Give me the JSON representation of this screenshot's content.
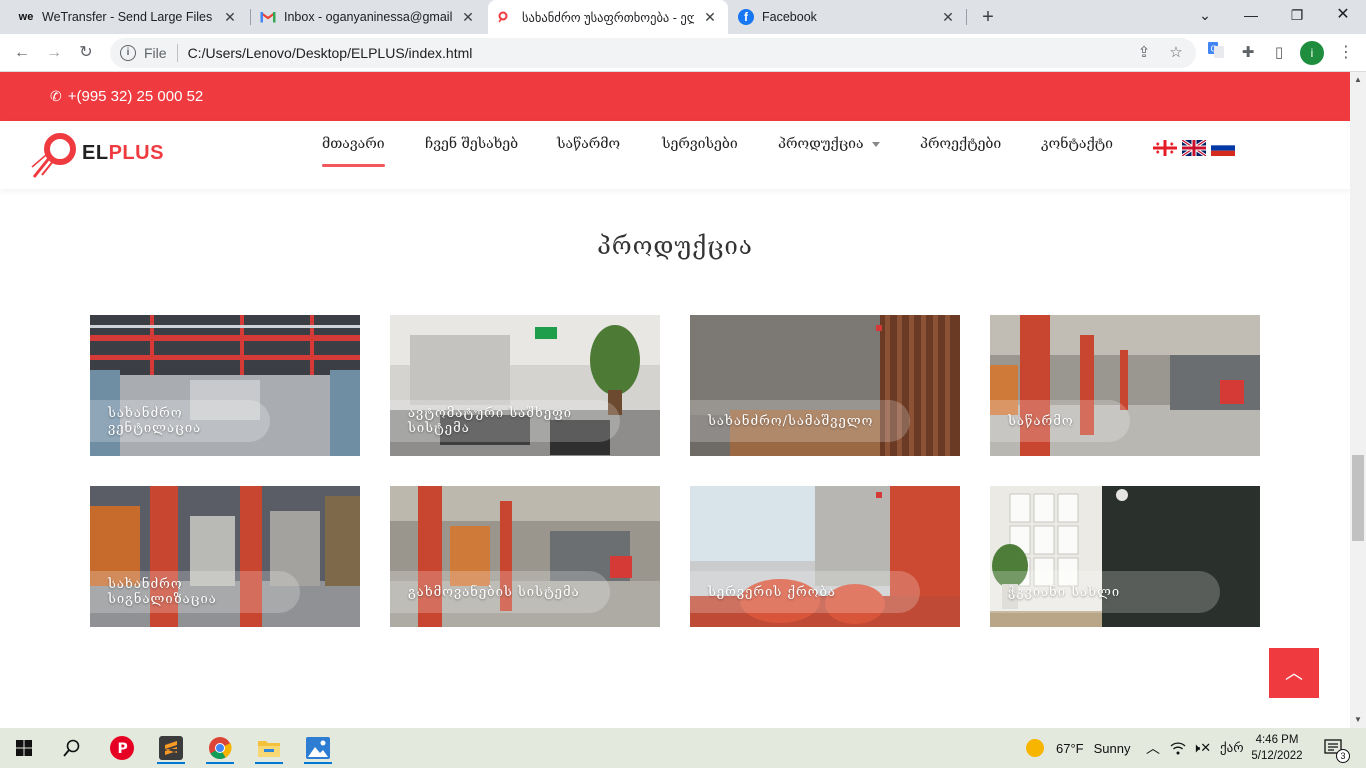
{
  "browser": {
    "tabs": [
      {
        "title": "WeTransfer - Send Large Files & S",
        "favicon": "WE",
        "active": false
      },
      {
        "title": "Inbox - oganyaninessa@gmail.co",
        "favicon": "M",
        "active": false
      },
      {
        "title": "სახანძრო უსაფრთხოება - ელ",
        "favicon": "logo",
        "active": true
      },
      {
        "title": "Facebook",
        "favicon": "f",
        "active": false
      }
    ],
    "scheme": "File",
    "url": "C:/Users/Lenovo/Desktop/ELPLUS/index.html",
    "profile_initial": "i"
  },
  "site": {
    "phone": "+(995 32) 25 000 52",
    "logo": {
      "part1": "EL",
      "part2": "PLUS"
    },
    "nav": [
      {
        "label": "მთავარი",
        "active": true
      },
      {
        "label": "ჩვენ შესახებ",
        "active": false
      },
      {
        "label": "საწარმო",
        "active": false
      },
      {
        "label": "სერვისები",
        "active": false
      },
      {
        "label": "პროდუქცია",
        "active": false,
        "dropdown": true
      },
      {
        "label": "პროექტები",
        "active": false
      },
      {
        "label": "კონტაქტი",
        "active": false
      }
    ],
    "languages": [
      "georgian-flag-icon",
      "uk-flag-icon",
      "russian-flag-icon"
    ],
    "section_title": "პროდუქცია",
    "products": [
      {
        "label": "სახანძრო ვენტილაცია",
        "scene": "ventilation-ceiling"
      },
      {
        "label": "ავტომატური საშხეფი სისტემა",
        "scene": "office-lounge"
      },
      {
        "label": "სახანძრო/სამაშველო",
        "scene": "reception-desk"
      },
      {
        "label": "საწარმო",
        "scene": "factory-hall"
      },
      {
        "label": "სახანძრო სიგნალიზაცია",
        "scene": "factory-booths"
      },
      {
        "label": "გახმოვანების სისტემა",
        "scene": "factory-corridor"
      },
      {
        "label": "სერვერის ქრობა",
        "scene": "meeting-room"
      },
      {
        "label": "ჭკვიანი სახლი",
        "scene": "smart-home"
      }
    ]
  },
  "taskbar": {
    "weather_temp": "67°F",
    "weather_desc": "Sunny",
    "lang": "ქარ",
    "time": "4:46 PM",
    "date": "5/12/2022",
    "notifications": "3"
  }
}
